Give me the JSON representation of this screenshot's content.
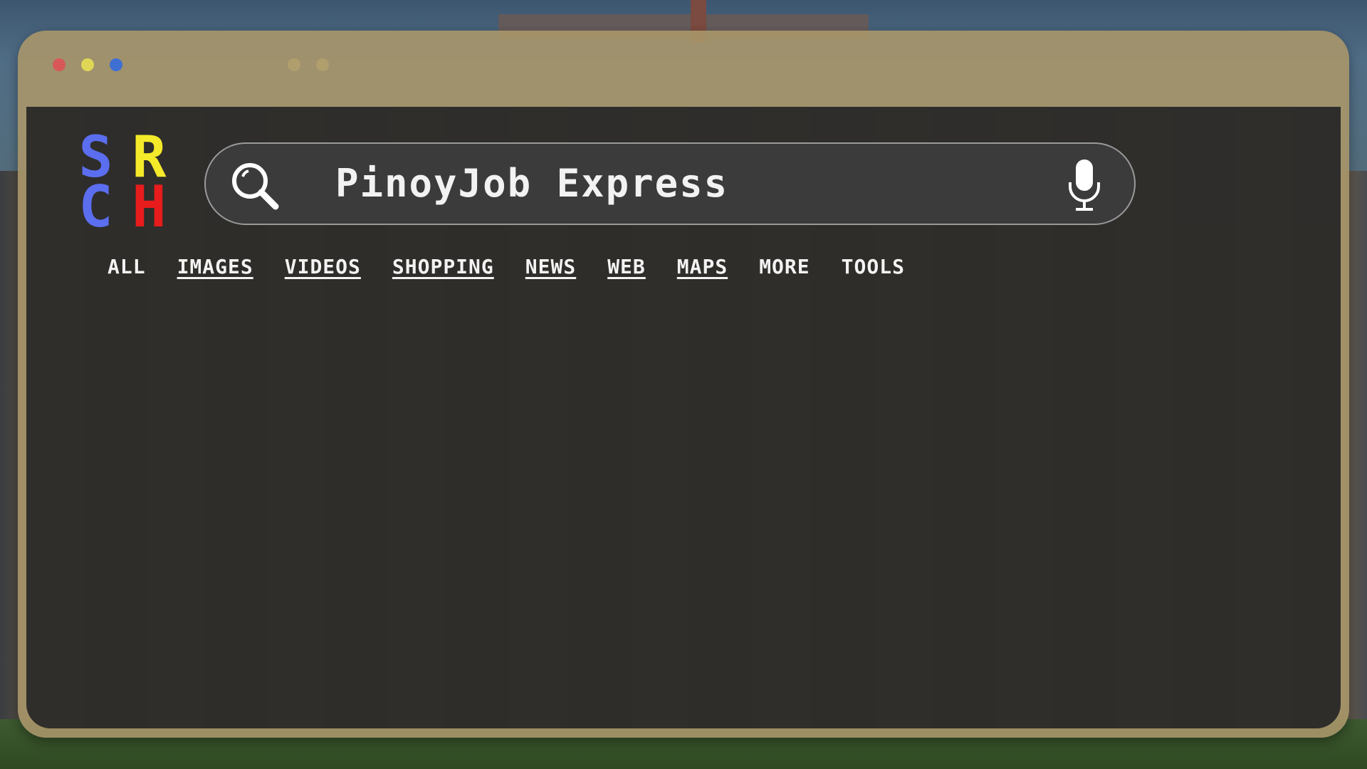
{
  "window": {
    "traffic_lights": [
      {
        "name": "close",
        "color": "#d85858"
      },
      {
        "name": "minimize",
        "color": "#e0d656"
      },
      {
        "name": "maximize",
        "color": "#3f6fd3"
      }
    ]
  },
  "logo": {
    "letters": [
      "S",
      "R",
      "C",
      "H"
    ],
    "colors": [
      "#5b6ef0",
      "#f4ea2a",
      "#5b6ef0",
      "#e81c1c"
    ]
  },
  "search": {
    "query": "PinoyJob Express",
    "search_icon": "magnifier-icon",
    "voice_icon": "microphone-icon"
  },
  "tabs": [
    {
      "label": "ALL",
      "underlined": false
    },
    {
      "label": "IMAGES",
      "underlined": true
    },
    {
      "label": "VIDEOS",
      "underlined": true
    },
    {
      "label": "SHOPPING",
      "underlined": true
    },
    {
      "label": "NEWS",
      "underlined": true
    },
    {
      "label": "WEB",
      "underlined": true
    },
    {
      "label": "MAPS",
      "underlined": true
    },
    {
      "label": "MORE",
      "underlined": false
    },
    {
      "label": "TOOLS",
      "underlined": false
    }
  ]
}
